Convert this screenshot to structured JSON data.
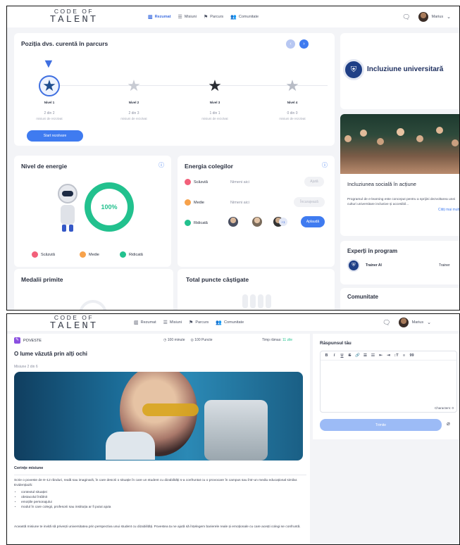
{
  "nav": {
    "logo_line1": "CODE OF",
    "logo_line2": "TALENT",
    "items": [
      {
        "label": "Rezumat",
        "icon": "map-icon"
      },
      {
        "label": "Misiuni",
        "icon": "list-icon"
      },
      {
        "label": "Parcurs",
        "icon": "flag-icon"
      },
      {
        "label": "Comunitate",
        "icon": "people-icon"
      }
    ],
    "user_name": "Marius"
  },
  "journey": {
    "title": "Poziția dvs. curentă în parcurs",
    "levels": [
      {
        "name": "Nivel 1",
        "count": "2 din 2",
        "sub": "misiuni de rezolvat"
      },
      {
        "name": "Nivel 2",
        "count": "2 din 3",
        "sub": "misiuni de rezolvat"
      },
      {
        "name": "Nivel 3",
        "count": "1 din 1",
        "sub": "misiuni de rezolvat"
      },
      {
        "name": "Nivel 4",
        "count": "0 din 0",
        "sub": "misiuni de rezolvat"
      }
    ],
    "start_button": "Start rezolvare"
  },
  "energy": {
    "title": "Nivel de energie",
    "percent": "100%",
    "legend": [
      "Scăzută",
      "Medie",
      "Ridicată"
    ],
    "colors": {
      "low": "#f2607a",
      "mid": "#f7a24b",
      "high": "#22c18e"
    }
  },
  "colleagues": {
    "title": "Energia colegilor",
    "rows": [
      {
        "label": "Scăzută",
        "placeholder": "Nimeni aici",
        "action": "Ajută"
      },
      {
        "label": "Medie",
        "placeholder": "Nimeni aici",
        "action": "Încurajează"
      },
      {
        "label": "Ridicată",
        "extra": "+1",
        "action": "Aplaudă"
      }
    ]
  },
  "medals": {
    "title": "Medalii primite"
  },
  "points": {
    "title": "Total puncte câștigate"
  },
  "sidebar": {
    "inclusion_title": "Incluziune universitară",
    "social_title": "Incluziunea socială în acțiune",
    "social_text": "Programul de e-learning este conceput pentru a sprijini dezvoltarea unei culturi universitare inclusive și accesibil...",
    "read_more": "Citiți mai mult",
    "experts_title": "Experți în program",
    "expert_name": "Trainer AI",
    "expert_role": "Trainer",
    "community_title": "Comunitate"
  },
  "mission": {
    "badge": "POVESTE",
    "duration": "100 minute",
    "points": "100 Puncte",
    "time_left_label": "Timp rămas:",
    "time_left_value": "11 zile",
    "title": "O lume văzută prin alți ochi",
    "subtitle": "Misiune 2 din 6",
    "requirements_title": "Cerințe misiune",
    "intro": "Scrie o poveste de 8–12 rânduri, reală sau imaginară, în care descrii o situație în care un student cu dizabilități s-a confruntat cu o provocare în campus sau într-un mediu educațional similar. Evidențiază:",
    "bullets": [
      "contextul situației",
      "obstacolul întâlnit",
      "emoțiile personajului",
      "modul în care colegii, profesorii sau instituția ar fi putut ajuta"
    ],
    "closing": "Această misiune te invită să privești universitatea prin perspectiva unui student cu dizabilități. Povestea ta ne ajută să înțelegem barierele reale și emoționale cu care acești colegi se confruntă."
  },
  "answer": {
    "title": "Răspunsul tău",
    "toolbar": [
      "B",
      "I",
      "U",
      "S",
      "🔗",
      "☰",
      "☷",
      "⇤",
      "⇥",
      "↕T",
      "≡",
      "99"
    ],
    "characters": "Characters: 0",
    "submit": "Trimite"
  }
}
